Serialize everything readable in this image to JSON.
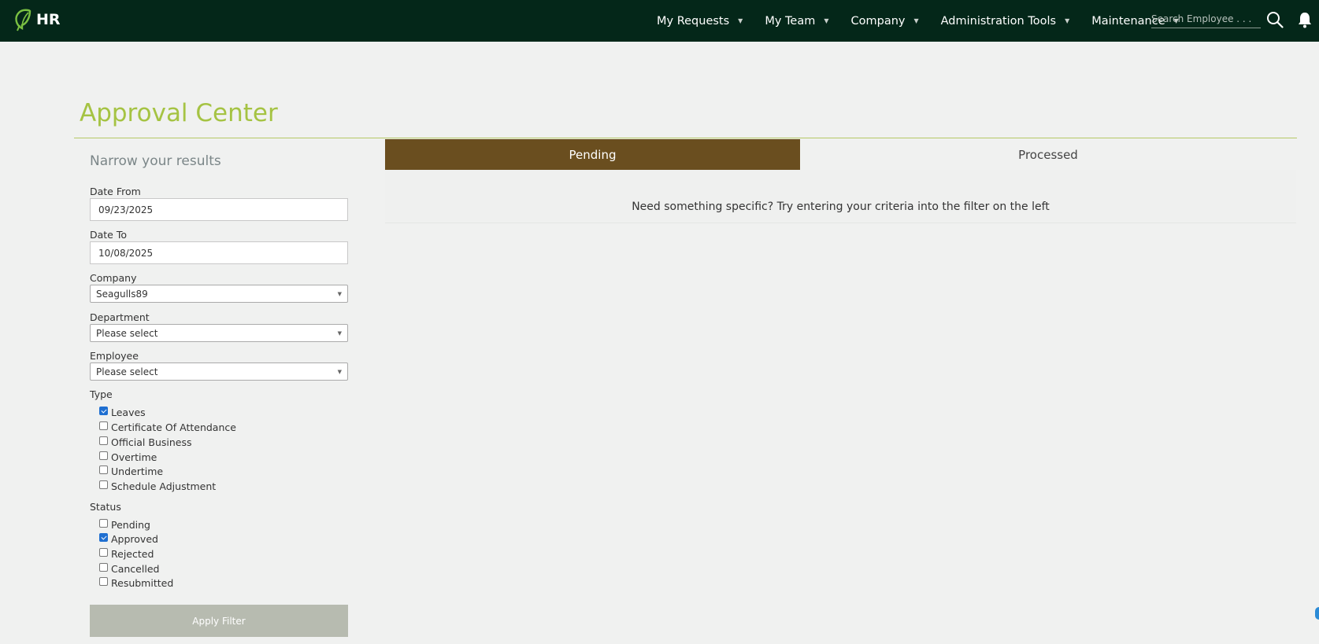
{
  "header": {
    "brand": "HR",
    "nav": [
      {
        "label": "My Requests"
      },
      {
        "label": "My Team"
      },
      {
        "label": "Company"
      },
      {
        "label": "Administration Tools"
      },
      {
        "label": "Maintenance"
      }
    ],
    "search_placeholder": "Search Employee . . ."
  },
  "page": {
    "title": "Approval Center"
  },
  "filter": {
    "heading": "Narrow your results",
    "date_from_label": "Date From",
    "date_from_value": "09/23/2025",
    "date_to_label": "Date To",
    "date_to_value": "10/08/2025",
    "company_label": "Company",
    "company_value": "Seagulls89",
    "department_label": "Department",
    "department_value": "Please select",
    "employee_label": "Employee",
    "employee_value": "Please select",
    "type_label": "Type",
    "types": [
      {
        "label": "Leaves",
        "checked": true
      },
      {
        "label": "Certificate Of Attendance",
        "checked": false
      },
      {
        "label": "Official Business",
        "checked": false
      },
      {
        "label": "Overtime",
        "checked": false
      },
      {
        "label": "Undertime",
        "checked": false
      },
      {
        "label": "Schedule Adjustment",
        "checked": false
      }
    ],
    "status_label": "Status",
    "statuses": [
      {
        "label": "Pending",
        "checked": false
      },
      {
        "label": "Approved",
        "checked": true
      },
      {
        "label": "Rejected",
        "checked": false
      },
      {
        "label": "Cancelled",
        "checked": false
      },
      {
        "label": "Resubmitted",
        "checked": false
      }
    ],
    "apply_label": "Apply Filter"
  },
  "tabs": [
    {
      "label": "Pending",
      "active": true
    },
    {
      "label": "Processed",
      "active": false
    }
  ],
  "content": {
    "hint": "Need something specific? Try entering your criteria into the filter on the left"
  },
  "colors": {
    "topbar": "#042719",
    "title": "#a5c343",
    "active_tab": "#6a4e1f",
    "apply_button": "#b7bbb0"
  }
}
